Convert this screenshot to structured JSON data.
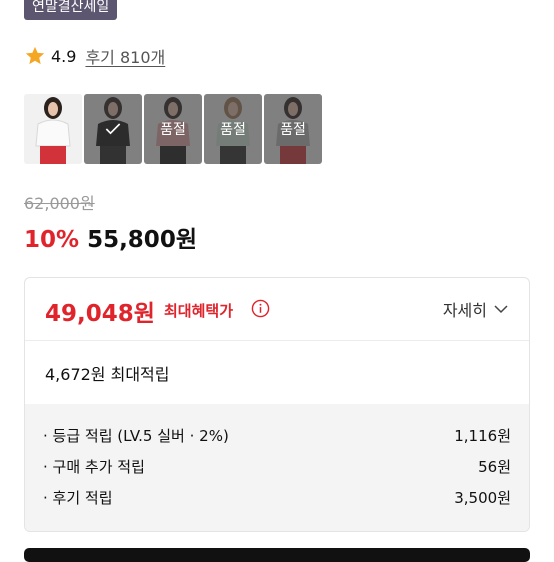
{
  "badge": "연말결산세일",
  "rating": {
    "value": "4.9",
    "review_text": "후기 810개",
    "star_color": "#f5a623"
  },
  "thumbnails": [
    {
      "label": "",
      "state": "default"
    },
    {
      "label": "",
      "state": "selected"
    },
    {
      "label": "품절",
      "state": "soldout"
    },
    {
      "label": "품절",
      "state": "soldout"
    },
    {
      "label": "품절",
      "state": "soldout"
    }
  ],
  "price": {
    "original": "62,000원",
    "discount": "10%",
    "sale": "55,800원"
  },
  "benefit": {
    "max_price": "49,048원",
    "max_label": "최대혜택가",
    "detail_label": "자세히",
    "points_total": "4,672원 최대적립",
    "rows": [
      {
        "label": "· 등급 적립 (LV.5 실버 · 2%)",
        "value": "1,116원"
      },
      {
        "label": "· 구매 추가 적립",
        "value": "56원"
      },
      {
        "label": "· 후기 적립",
        "value": "3,500원"
      }
    ]
  },
  "colors": {
    "accent_red": "#e0242c",
    "badge_bg": "#5c5670"
  }
}
